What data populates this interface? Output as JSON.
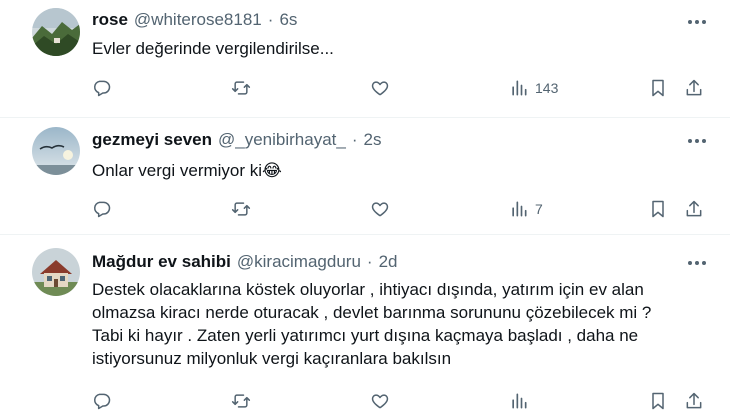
{
  "tweets": [
    {
      "name": "rose",
      "handle": "@whiterose8181",
      "separator": "·",
      "time": "6s",
      "lines": [
        "Evler değerinde vergilendirilse..."
      ],
      "views": "143",
      "avatar_icon": "forest-mountain-avatar"
    },
    {
      "name": "gezmeyi seven",
      "handle": "@_yenibirhayat_",
      "separator": "·",
      "time": "2s",
      "lines": [
        "Onlar vergi vermiyor ki"
      ],
      "emoji": "😂",
      "views": "7",
      "avatar_icon": "bird-sky-avatar"
    },
    {
      "name": "Mağdur ev sahibi",
      "handle": "@kiracimagduru",
      "separator": "·",
      "time": "2d",
      "lines": [
        "Destek olacaklarına köstek oluyorlar , ihtiyacı dışında, yatırım için ev alan",
        "olmazsa kiracı nerde oturacak , devlet barınma sorununu çözebilecek mi ?",
        "Tabi ki hayır . Zaten yerli yatırımcı yurt dışına kaçmaya başladı , daha ne",
        "istiyorsunuz milyonluk vergi kaçıranlara bakılsın"
      ],
      "views": "",
      "avatar_icon": "house-avatar"
    }
  ],
  "colors": {
    "text_primary": "#0f1419",
    "text_secondary": "#536471",
    "divider": "#eff3f4"
  }
}
